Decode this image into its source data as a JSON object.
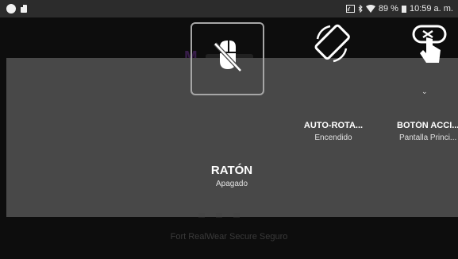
{
  "status_bar": {
    "battery_percent": "89 %",
    "time": "10:59 a. m."
  },
  "quick_tiles": [
    {
      "label": "RATÓN",
      "status": "Apagado",
      "icon": "mouse-off-icon",
      "focused": true
    },
    {
      "label": "AUTO-ROTA...",
      "status": "Encendido",
      "icon": "screen-rotation-icon",
      "focused": false
    },
    {
      "label": "BOTÓN ACCI...",
      "status": "Pantalla Princi...",
      "icon": "touch-button-icon",
      "focused": false
    }
  ],
  "footer_text": "Fort RealWear Secure Seguro",
  "colors": {
    "overlay": "#484848",
    "background": "#0d0d0d",
    "status_bar": "#2c2c2c"
  }
}
